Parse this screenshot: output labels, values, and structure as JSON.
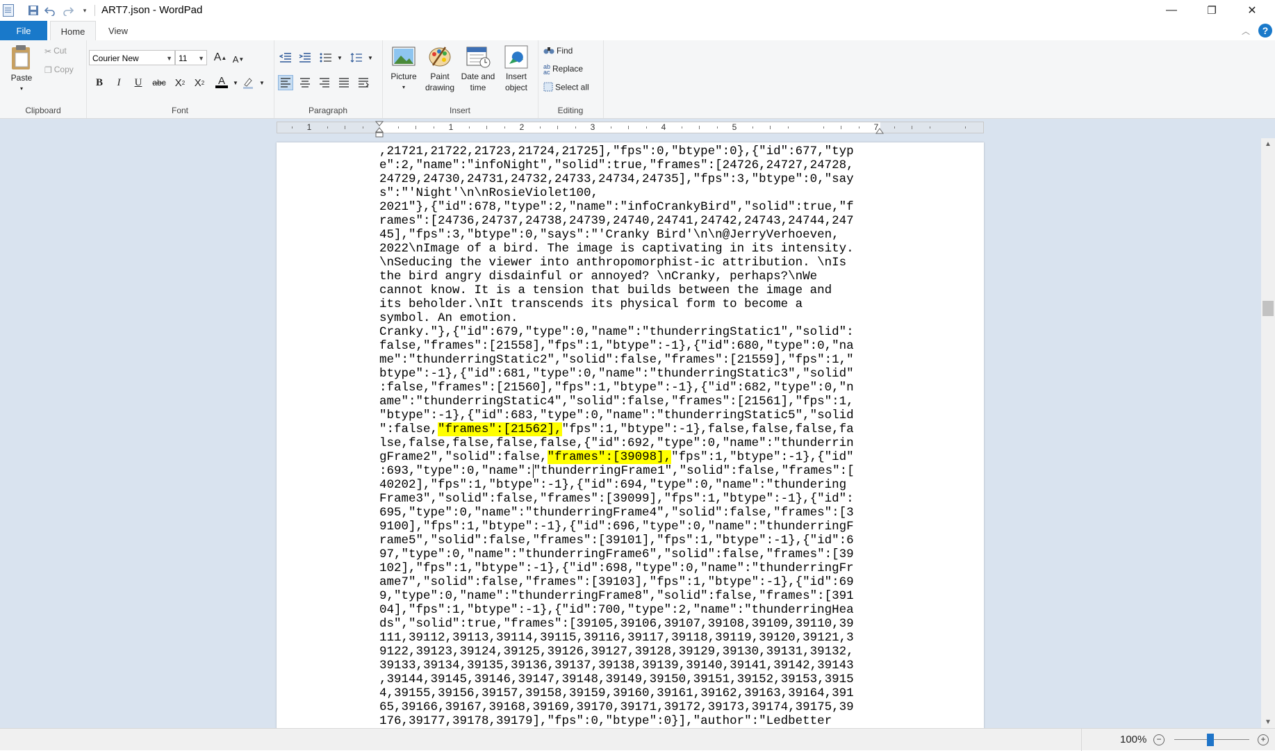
{
  "window": {
    "title": "ART7.json - WordPad",
    "controls": {
      "minimize": "—",
      "restore": "❐",
      "close": "✕"
    }
  },
  "tabs": {
    "file": "File",
    "home": "Home",
    "view": "View",
    "help": "?"
  },
  "ribbon": {
    "clipboard": {
      "group_label": "Clipboard",
      "paste": "Paste",
      "cut": "Cut",
      "copy": "Copy"
    },
    "font": {
      "group_label": "Font",
      "family": "Courier New",
      "size": "11",
      "grow": "A",
      "shrink": "A",
      "bold": "B",
      "italic": "I",
      "underline": "U",
      "strike": "abc",
      "subscript": "X",
      "superscript": "X",
      "color_letter": "A"
    },
    "paragraph": {
      "group_label": "Paragraph"
    },
    "insert": {
      "group_label": "Insert",
      "picture": "Picture",
      "paint1": "Paint",
      "paint2": "drawing",
      "datetime1": "Date and",
      "datetime2": "time",
      "object1": "Insert",
      "object2": "object"
    },
    "editing": {
      "group_label": "Editing",
      "find": "Find",
      "replace": "Replace",
      "select_all": "Select all"
    }
  },
  "ruler": {
    "labels": [
      "1",
      "1",
      "2",
      "3",
      "4",
      "5",
      "7"
    ]
  },
  "document": {
    "pre": ",21721,21722,21723,21724,21725],\"fps\":0,\"btype\":0},{\"id\":677,\"typ\ne\":2,\"name\":\"infoNight\",\"solid\":true,\"frames\":[24726,24727,24728,\n24729,24730,24731,24732,24733,24734,24735],\"fps\":3,\"btype\":0,\"say\ns\":\"'Night'\\n\\nRosieViolet100,\n2021\"},{\"id\":678,\"type\":2,\"name\":\"infoCrankyBird\",\"solid\":true,\"f\nrames\":[24736,24737,24738,24739,24740,24741,24742,24743,24744,247\n45],\"fps\":3,\"btype\":0,\"says\":\"'Cranky Bird'\\n\\n@JerryVerhoeven,\n2022\\nImage of a bird. The image is captivating in its intensity.\n\\nSeducing the viewer into anthropomorphist-ic attribution. \\nIs\nthe bird angry disdainful or annoyed? \\nCranky, perhaps?\\nWe\ncannot know. It is a tension that builds between the image and\nits beholder.\\nIt transcends its physical form to become a\nsymbol. An emotion.\nCranky.\"},{\"id\":679,\"type\":0,\"name\":\"thunderringStatic1\",\"solid\":\nfalse,\"frames\":[21558],\"fps\":1,\"btype\":-1},{\"id\":680,\"type\":0,\"na\nme\":\"thunderringStatic2\",\"solid\":false,\"frames\":[21559],\"fps\":1,\"\nbtype\":-1},{\"id\":681,\"type\":0,\"name\":\"thunderringStatic3\",\"solid\"\n:false,\"frames\":[21560],\"fps\":1,\"btype\":-1},{\"id\":682,\"type\":0,\"n\name\":\"thunderringStatic4\",\"solid\":false,\"frames\":[21561],\"fps\":1,\n\"btype\":-1},{\"id\":683,\"type\":0,\"name\":\"thunderringStatic5\",\"solid\n\":false,",
    "hl1": "\"frames\":[21562],",
    "mid1": "\"fps\":1,\"btype\":-1},false,false,false,fa\nlse,false,false,false,false,{\"id\":692,\"type\":0,\"name\":\"thunderrin\ngFrame2\",\"solid\":false,",
    "hl2": "\"frames\":[39098],",
    "mid2": "\"fps\":1,\"btype\":-1},{\"id\"\n:693,\"type\":0,\"name\":",
    "post": "\"thunderringFrame1\",\"solid\":false,\"frames\":[\n40202],\"fps\":1,\"btype\":-1},{\"id\":694,\"type\":0,\"name\":\"thundering\nFrame3\",\"solid\":false,\"frames\":[39099],\"fps\":1,\"btype\":-1},{\"id\":\n695,\"type\":0,\"name\":\"thunderringFrame4\",\"solid\":false,\"frames\":[3\n9100],\"fps\":1,\"btype\":-1},{\"id\":696,\"type\":0,\"name\":\"thunderringF\nrame5\",\"solid\":false,\"frames\":[39101],\"fps\":1,\"btype\":-1},{\"id\":6\n97,\"type\":0,\"name\":\"thunderringFrame6\",\"solid\":false,\"frames\":[39\n102],\"fps\":1,\"btype\":-1},{\"id\":698,\"type\":0,\"name\":\"thunderringFr\name7\",\"solid\":false,\"frames\":[39103],\"fps\":1,\"btype\":-1},{\"id\":69\n9,\"type\":0,\"name\":\"thunderringFrame8\",\"solid\":false,\"frames\":[391\n04],\"fps\":1,\"btype\":-1},{\"id\":700,\"type\":2,\"name\":\"thunderringHea\nds\",\"solid\":true,\"frames\":[39105,39106,39107,39108,39109,39110,39\n111,39112,39113,39114,39115,39116,39117,39118,39119,39120,39121,3\n9122,39123,39124,39125,39126,39127,39128,39129,39130,39131,39132,\n39133,39134,39135,39136,39137,39138,39139,39140,39141,39142,39143\n,39144,39145,39146,39147,39148,39149,39150,39151,39152,39153,3915\n4,39155,39156,39157,39158,39159,39160,39161,39162,39163,39164,391\n65,39166,39167,39168,39169,39170,39171,39172,39173,39174,39175,39\n176,39177,39178,39179],\"fps\":0,\"btype\":0}],\"author\":\"Ledbetter",
    "highlight_color": "#ffff00"
  },
  "statusbar": {
    "zoom": "100%",
    "zoom_out": "−",
    "zoom_in": "+"
  },
  "colors": {
    "accent": "#1979ca",
    "workspace": "#d9e3ef",
    "ribbon": "#f5f6f7"
  }
}
